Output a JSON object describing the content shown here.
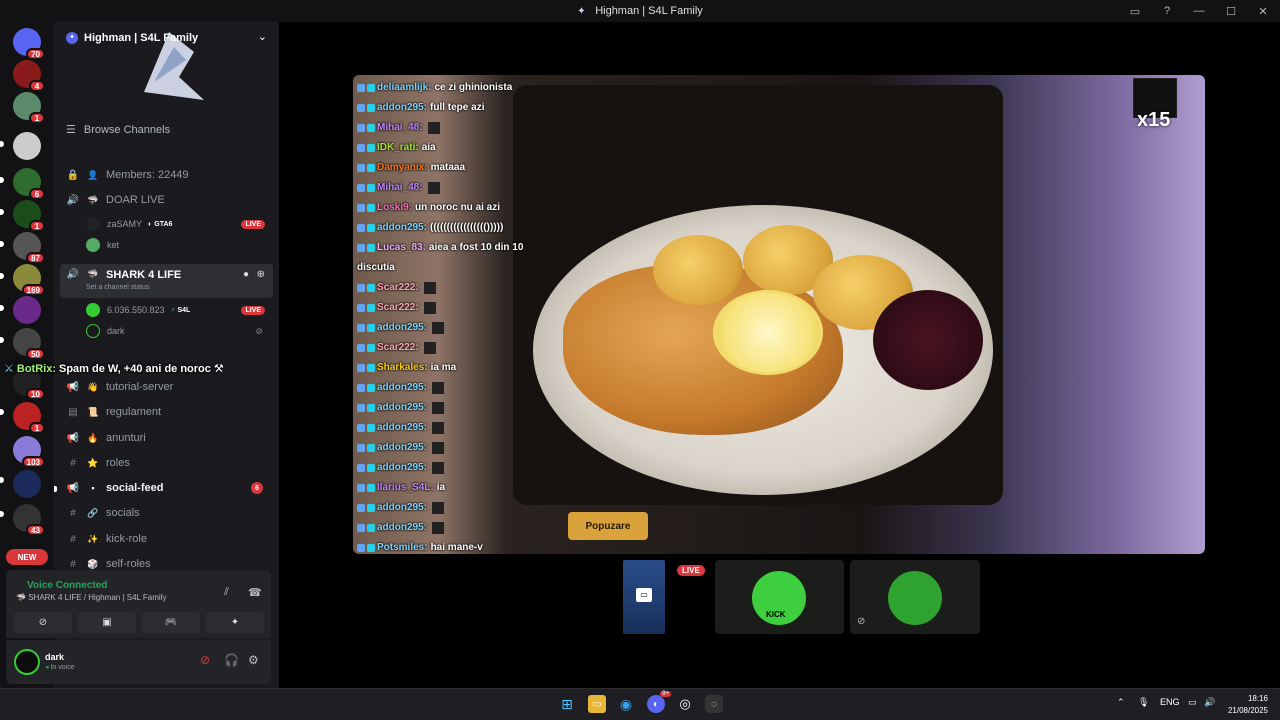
{
  "window": {
    "title": "Highman | S4L Family",
    "icons": [
      "inbox-icon",
      "help-icon",
      "minimize-icon",
      "maximize-icon",
      "close-icon"
    ]
  },
  "guilds": {
    "badges": [
      "70",
      "4",
      "1",
      "6",
      "1",
      "87",
      "169",
      "50",
      "10",
      "1",
      "103",
      "43"
    ],
    "new_label": "NEW"
  },
  "server": {
    "name": "Highman | S4L Family",
    "browse_label": "Browse Channels"
  },
  "channels": {
    "members": "Members: 22449",
    "doar_live": "DOAR LIVE",
    "shark_4_life": "SHARK 4 LIFE",
    "shark_status": "Set a channel status",
    "tutorial": "tutorial-server",
    "regulament": "regulament",
    "anunturi": "anunturi",
    "roles": "roles",
    "social_feed": "social-feed",
    "social_feed_unread": "6",
    "socials": "socials",
    "kick_role": "kick-role",
    "self_roles": "self-roles"
  },
  "voice_users": {
    "doar_live": [
      {
        "name": "zaSAMY",
        "tag": "GTA6",
        "live": "LIVE"
      },
      {
        "name": "ket"
      }
    ],
    "shark": [
      {
        "name": "6.036.550.823",
        "tag": "S4L",
        "live": "LIVE"
      },
      {
        "name": "dark"
      }
    ]
  },
  "bot_overlay": {
    "name": "BotRix:",
    "message": "Spam de W, +40 ani de noroc"
  },
  "voice_panel": {
    "title": "Voice Connected",
    "location": "SHARK 4 LIFE / Highman | S4L Family"
  },
  "user": {
    "name": "dark",
    "status": "In voice"
  },
  "stream": {
    "x15": "x15",
    "popup_label": "Popuzare",
    "chat": [
      {
        "user": "deliaamlijk:",
        "msg": "ce zi ghinionista",
        "color": "#7dd3fc"
      },
      {
        "user": "addon295:",
        "msg": "full tepe azi",
        "color": "#7dd3fc"
      },
      {
        "user": "Mihai_48:",
        "msg": "",
        "color": "#c084fc"
      },
      {
        "user": "IDK_rati:",
        "msg": "aia",
        "color": "#a3e635"
      },
      {
        "user": "Damyanix:",
        "msg": "mataaa",
        "color": "#f97316"
      },
      {
        "user": "Mihai_48:",
        "msg": "",
        "color": "#c084fc"
      },
      {
        "user": "Loski9:",
        "msg": "un noroc nu ai azi",
        "color": "#f472b6"
      },
      {
        "user": "addon295:",
        "msg": "((((((((((((((((()))))",
        "color": "#7dd3fc"
      },
      {
        "user": "Lucas_83:",
        "msg": "aiea a fost 10 din 10",
        "color": "#f0abfc"
      },
      {
        "user": "",
        "msg": "discutia",
        "color": "#ffffff"
      },
      {
        "user": "Scar222:",
        "msg": "",
        "color": "#fda4af"
      },
      {
        "user": "Scar222:",
        "msg": "",
        "color": "#fda4af"
      },
      {
        "user": "addon295:",
        "msg": "",
        "color": "#7dd3fc"
      },
      {
        "user": "Scar222:",
        "msg": "",
        "color": "#fda4af"
      },
      {
        "user": "Sharkales:",
        "msg": "ia ma",
        "color": "#facc15"
      },
      {
        "user": "addon295:",
        "msg": "",
        "color": "#7dd3fc"
      },
      {
        "user": "addon295:",
        "msg": "",
        "color": "#7dd3fc"
      },
      {
        "user": "addon295:",
        "msg": "",
        "color": "#7dd3fc"
      },
      {
        "user": "addon295:",
        "msg": "",
        "color": "#7dd3fc"
      },
      {
        "user": "addon295:",
        "msg": "",
        "color": "#7dd3fc"
      },
      {
        "user": "Ilarius_S4L:",
        "msg": "ia",
        "color": "#c084fc"
      },
      {
        "user": "addon295:",
        "msg": "",
        "color": "#7dd3fc"
      },
      {
        "user": "addon295:",
        "msg": "",
        "color": "#7dd3fc"
      },
      {
        "user": "Potsmiles:",
        "msg": "hai mane-v",
        "color": "#7dd3fc"
      }
    ],
    "tile_live": "LIVE",
    "kick_label": "KICK"
  },
  "taskbar": {
    "lang": "ENG",
    "time": "18:16",
    "date": "21/08/2025",
    "discord_badge": "9+"
  },
  "colors": {
    "accent": "#5865f2",
    "live_red": "#da373c",
    "voice_green": "#23a55a"
  }
}
